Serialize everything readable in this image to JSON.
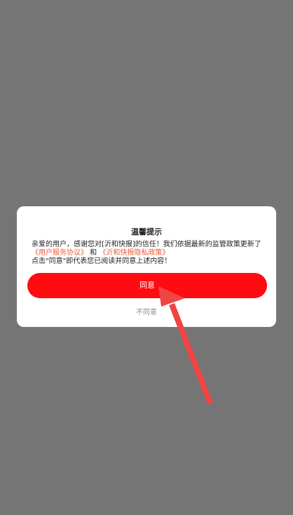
{
  "dialog": {
    "title": "温馨提示",
    "line1": "亲爱的用户，感谢您对[沂和快报]的信任！我们依据最新的监管政策更新了",
    "link_terms": "《用户服务协议》",
    "and_text": " 和 ",
    "link_privacy": "《沂和快报隐私政策》",
    "line3": "点击\"同意\"即代表您已阅读并同意上述内容！",
    "agree_label": "同意",
    "disagree_label": "不同意"
  },
  "colors": {
    "overlay": "#757575",
    "accent": "#ff0b10",
    "link": "#f05a3a",
    "arrow": "#f04545"
  }
}
